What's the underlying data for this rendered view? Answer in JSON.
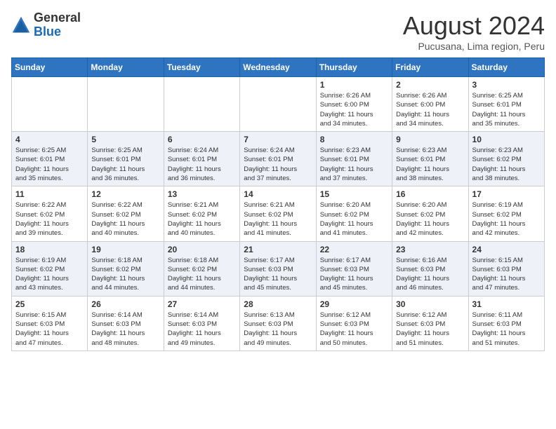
{
  "header": {
    "logo_general": "General",
    "logo_blue": "Blue",
    "month_title": "August 2024",
    "subtitle": "Pucusana, Lima region, Peru"
  },
  "days_of_week": [
    "Sunday",
    "Monday",
    "Tuesday",
    "Wednesday",
    "Thursday",
    "Friday",
    "Saturday"
  ],
  "weeks": [
    [
      {
        "day": "",
        "info": ""
      },
      {
        "day": "",
        "info": ""
      },
      {
        "day": "",
        "info": ""
      },
      {
        "day": "",
        "info": ""
      },
      {
        "day": "1",
        "info": "Sunrise: 6:26 AM\nSunset: 6:00 PM\nDaylight: 11 hours\nand 34 minutes."
      },
      {
        "day": "2",
        "info": "Sunrise: 6:26 AM\nSunset: 6:00 PM\nDaylight: 11 hours\nand 34 minutes."
      },
      {
        "day": "3",
        "info": "Sunrise: 6:25 AM\nSunset: 6:01 PM\nDaylight: 11 hours\nand 35 minutes."
      }
    ],
    [
      {
        "day": "4",
        "info": "Sunrise: 6:25 AM\nSunset: 6:01 PM\nDaylight: 11 hours\nand 35 minutes."
      },
      {
        "day": "5",
        "info": "Sunrise: 6:25 AM\nSunset: 6:01 PM\nDaylight: 11 hours\nand 36 minutes."
      },
      {
        "day": "6",
        "info": "Sunrise: 6:24 AM\nSunset: 6:01 PM\nDaylight: 11 hours\nand 36 minutes."
      },
      {
        "day": "7",
        "info": "Sunrise: 6:24 AM\nSunset: 6:01 PM\nDaylight: 11 hours\nand 37 minutes."
      },
      {
        "day": "8",
        "info": "Sunrise: 6:23 AM\nSunset: 6:01 PM\nDaylight: 11 hours\nand 37 minutes."
      },
      {
        "day": "9",
        "info": "Sunrise: 6:23 AM\nSunset: 6:01 PM\nDaylight: 11 hours\nand 38 minutes."
      },
      {
        "day": "10",
        "info": "Sunrise: 6:23 AM\nSunset: 6:02 PM\nDaylight: 11 hours\nand 38 minutes."
      }
    ],
    [
      {
        "day": "11",
        "info": "Sunrise: 6:22 AM\nSunset: 6:02 PM\nDaylight: 11 hours\nand 39 minutes."
      },
      {
        "day": "12",
        "info": "Sunrise: 6:22 AM\nSunset: 6:02 PM\nDaylight: 11 hours\nand 40 minutes."
      },
      {
        "day": "13",
        "info": "Sunrise: 6:21 AM\nSunset: 6:02 PM\nDaylight: 11 hours\nand 40 minutes."
      },
      {
        "day": "14",
        "info": "Sunrise: 6:21 AM\nSunset: 6:02 PM\nDaylight: 11 hours\nand 41 minutes."
      },
      {
        "day": "15",
        "info": "Sunrise: 6:20 AM\nSunset: 6:02 PM\nDaylight: 11 hours\nand 41 minutes."
      },
      {
        "day": "16",
        "info": "Sunrise: 6:20 AM\nSunset: 6:02 PM\nDaylight: 11 hours\nand 42 minutes."
      },
      {
        "day": "17",
        "info": "Sunrise: 6:19 AM\nSunset: 6:02 PM\nDaylight: 11 hours\nand 42 minutes."
      }
    ],
    [
      {
        "day": "18",
        "info": "Sunrise: 6:19 AM\nSunset: 6:02 PM\nDaylight: 11 hours\nand 43 minutes."
      },
      {
        "day": "19",
        "info": "Sunrise: 6:18 AM\nSunset: 6:02 PM\nDaylight: 11 hours\nand 44 minutes."
      },
      {
        "day": "20",
        "info": "Sunrise: 6:18 AM\nSunset: 6:02 PM\nDaylight: 11 hours\nand 44 minutes."
      },
      {
        "day": "21",
        "info": "Sunrise: 6:17 AM\nSunset: 6:03 PM\nDaylight: 11 hours\nand 45 minutes."
      },
      {
        "day": "22",
        "info": "Sunrise: 6:17 AM\nSunset: 6:03 PM\nDaylight: 11 hours\nand 45 minutes."
      },
      {
        "day": "23",
        "info": "Sunrise: 6:16 AM\nSunset: 6:03 PM\nDaylight: 11 hours\nand 46 minutes."
      },
      {
        "day": "24",
        "info": "Sunrise: 6:15 AM\nSunset: 6:03 PM\nDaylight: 11 hours\nand 47 minutes."
      }
    ],
    [
      {
        "day": "25",
        "info": "Sunrise: 6:15 AM\nSunset: 6:03 PM\nDaylight: 11 hours\nand 47 minutes."
      },
      {
        "day": "26",
        "info": "Sunrise: 6:14 AM\nSunset: 6:03 PM\nDaylight: 11 hours\nand 48 minutes."
      },
      {
        "day": "27",
        "info": "Sunrise: 6:14 AM\nSunset: 6:03 PM\nDaylight: 11 hours\nand 49 minutes."
      },
      {
        "day": "28",
        "info": "Sunrise: 6:13 AM\nSunset: 6:03 PM\nDaylight: 11 hours\nand 49 minutes."
      },
      {
        "day": "29",
        "info": "Sunrise: 6:12 AM\nSunset: 6:03 PM\nDaylight: 11 hours\nand 50 minutes."
      },
      {
        "day": "30",
        "info": "Sunrise: 6:12 AM\nSunset: 6:03 PM\nDaylight: 11 hours\nand 51 minutes."
      },
      {
        "day": "31",
        "info": "Sunrise: 6:11 AM\nSunset: 6:03 PM\nDaylight: 11 hours\nand 51 minutes."
      }
    ]
  ]
}
